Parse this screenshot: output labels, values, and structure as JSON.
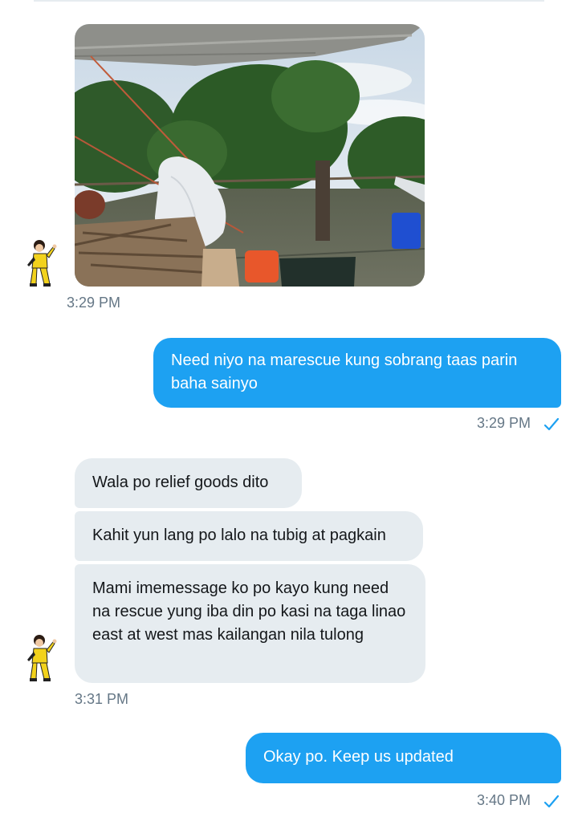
{
  "conversation": {
    "messages": [
      {
        "direction": "incoming",
        "type": "image",
        "time": "3:29 PM"
      },
      {
        "direction": "outgoing",
        "text": "Need niyo na marescue kung sobrang taas parin baha sainyo",
        "time": "3:29 PM",
        "status": "sent"
      },
      {
        "direction": "incoming",
        "text": "Wala po relief goods dito"
      },
      {
        "direction": "incoming",
        "text": "Kahit yun lang po lalo na tubig at pagkain"
      },
      {
        "direction": "incoming",
        "text": "Mami imemessage ko po kayo kung need na rescue yung iba din po kasi na taga linao east at west mas kailangan nila tulong",
        "time": "3:31 PM"
      },
      {
        "direction": "outgoing",
        "text": "Okay po. Keep us updated",
        "time": "3:40 PM",
        "status": "sent"
      }
    ]
  },
  "icons": {
    "avatar": "avatar-figure-yellow-suit",
    "sent_status": "checkmark-icon"
  },
  "colors": {
    "outgoing_bubble": "#1da1f2",
    "incoming_bubble": "#e6ecf0",
    "timestamp": "#657786",
    "check": "#1da1f2"
  }
}
